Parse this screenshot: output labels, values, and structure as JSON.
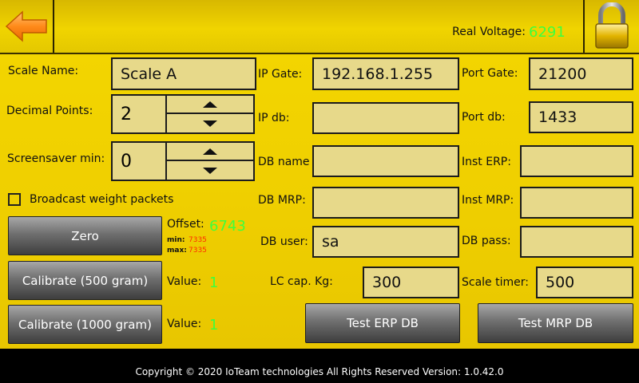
{
  "header": {
    "back_icon": "arrow-left-icon",
    "lock_icon": "padlock-icon",
    "real_voltage_label": "Real Voltage:",
    "real_voltage_value": "6291"
  },
  "left": {
    "scale_name_label": "Scale Name:",
    "scale_name_value": "Scale A",
    "decimal_points_label": "Decimal Points:",
    "decimal_points_value": "2",
    "screensaver_label": "Screensaver min:",
    "screensaver_value": "0",
    "broadcast_label": "Broadcast weight packets",
    "broadcast_checked": false,
    "zero_label": "Zero",
    "offset_label": "Offset:",
    "offset_value": "6743",
    "min_label": "min:",
    "min_value": "7335",
    "max_label": "max:",
    "max_value": "7335",
    "cal500_label": "Calibrate (500 gram)",
    "cal500_value_label": "Value:",
    "cal500_value": "1",
    "cal1000_label": "Calibrate (1000 gram)",
    "cal1000_value_label": "Value:",
    "cal1000_value": "1"
  },
  "network": {
    "ip_gate_label": "IP Gate:",
    "ip_gate_value": "192.168.1.255",
    "port_gate_label": "Port Gate:",
    "port_gate_value": "21200",
    "ip_db_label": "IP db:",
    "ip_db_value": "",
    "port_db_label": "Port db:",
    "port_db_value": "1433",
    "db_name_label": "DB name",
    "db_name_value": "",
    "inst_erp_label": "Inst ERP:",
    "inst_erp_value": "",
    "db_mrp_label": "DB MRP:",
    "db_mrp_value": "",
    "inst_mrp_label": "Inst MRP:",
    "inst_mrp_value": "",
    "db_user_label": "DB user:",
    "db_user_value": "sa",
    "db_pass_label": "DB pass:",
    "db_pass_value": "",
    "lc_cap_label": "LC cap. Kg:",
    "lc_cap_value": "300",
    "scale_timer_label": "Scale timer:",
    "scale_timer_value": "500",
    "test_erp_label": "Test ERP DB",
    "test_mrp_label": "Test MRP DB"
  },
  "footer": {
    "copyright": "Copyright © 2020 IoTeam technologies All Rights Reserved Version: 1.0.42.0"
  }
}
